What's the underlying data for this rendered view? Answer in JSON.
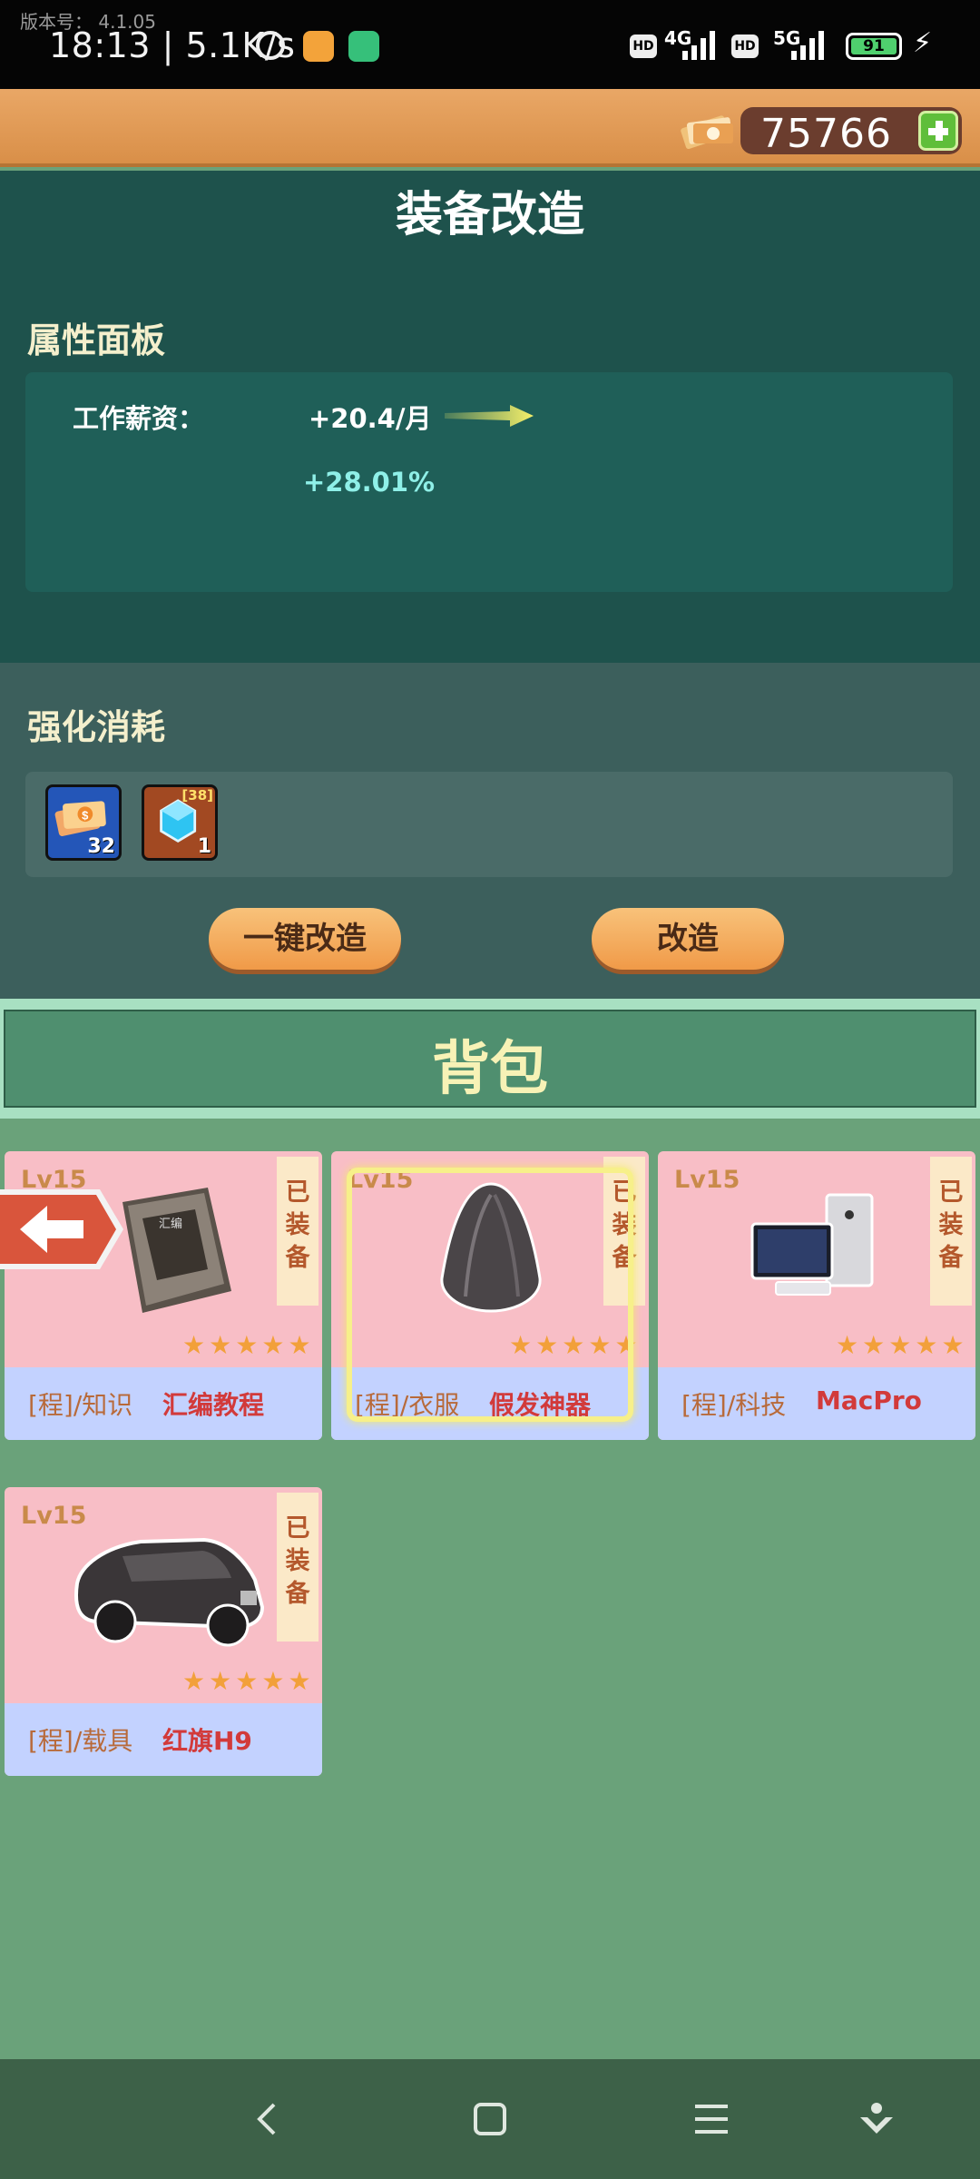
{
  "status_bar": {
    "version": "版本号： 4.1.05",
    "time": "18:13",
    "speed": "5.1K/s",
    "signal1": "4G",
    "signal2": "5G",
    "hd": "HD",
    "battery": "91"
  },
  "topbar": {
    "currency_value": "75766"
  },
  "page": {
    "title": "装备改造"
  },
  "attributes": {
    "heading": "属性面板",
    "label": "工作薪资：",
    "value": "+20.4/月",
    "increase": "+28.01%"
  },
  "cost": {
    "heading": "强化消耗",
    "items": [
      {
        "name": "money-ticket",
        "count": "32"
      },
      {
        "name": "blue-gem",
        "count": "1",
        "tag": "38"
      }
    ],
    "one_click_label": "一键改造",
    "modify_label": "改造"
  },
  "backpack": {
    "title": "背包",
    "cards": [
      {
        "level": "Lv15",
        "equipped": "已装备",
        "category": "[程]/知识",
        "name": "汇编教程",
        "stars": 5,
        "icon": "book-icon"
      },
      {
        "level": "Lv15",
        "equipped": "已装备",
        "category": "[程]/衣服",
        "name": "假发神器",
        "stars": 5,
        "icon": "wig-icon"
      },
      {
        "level": "Lv15",
        "equipped": "已装备",
        "category": "[程]/科技",
        "name": "MacPro",
        "stars": 5,
        "icon": "computer-icon"
      },
      {
        "level": "Lv15",
        "equipped": "已装备",
        "category": "[程]/载具",
        "name": "红旗H9",
        "stars": 5,
        "icon": "car-icon"
      }
    ]
  },
  "colors": {
    "accent_orange": "#f09a48",
    "panel_dark": "#1e524c",
    "background": "#6aa27a"
  }
}
